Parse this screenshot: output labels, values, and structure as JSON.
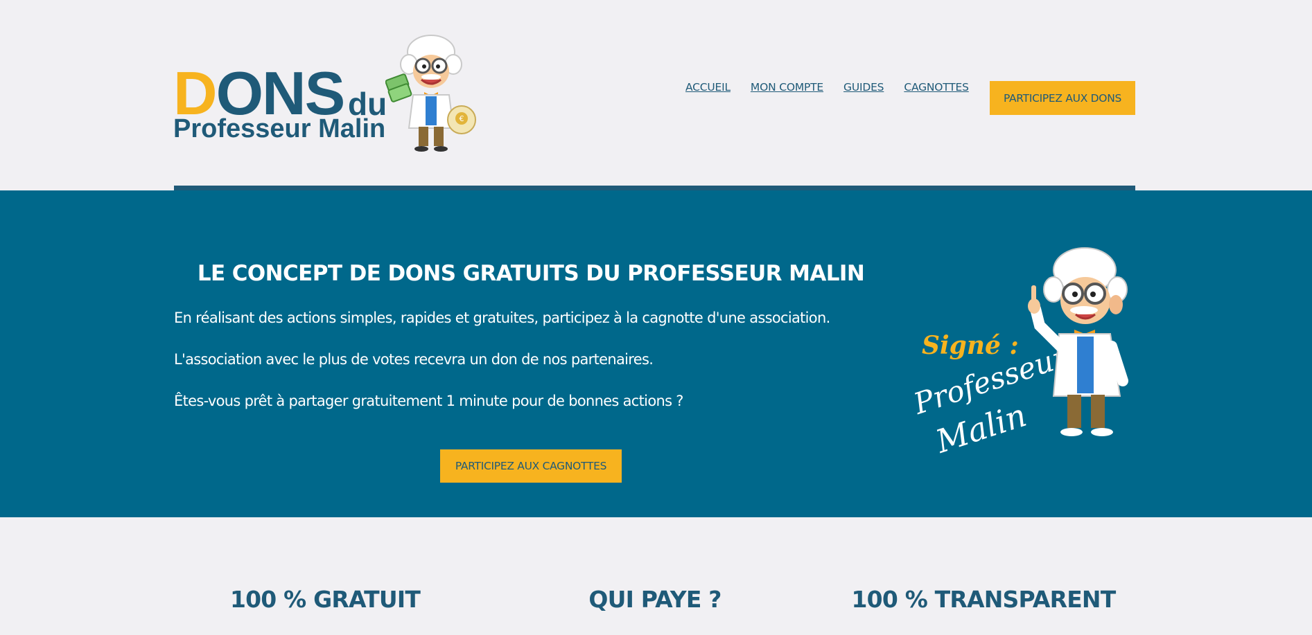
{
  "logo": {
    "word_first": "D",
    "word_rest": "ONS",
    "word_du": "du",
    "subtitle": "Professeur Malin",
    "coin_symbol": "€"
  },
  "nav": {
    "items": [
      {
        "label": "ACCUEIL"
      },
      {
        "label": "MON COMPTE"
      },
      {
        "label": "GUIDES"
      },
      {
        "label": "CAGNOTTES"
      }
    ],
    "cta_label": "PARTICIPEZ AUX DONS"
  },
  "hero": {
    "title": "LE CONCEPT DE DONS GRATUITS DU PROFESSEUR MALIN",
    "paragraphs": [
      "En réalisant des actions simples, rapides et gratuites, participez à la cagnotte d'une association.",
      "L'association avec le plus de votes recevra un don de nos partenaires.",
      "Êtes-vous prêt à partager gratuitement 1 minute pour de bonnes actions ?"
    ],
    "cta_label": "PARTICIPEZ AUX CAGNOTTES",
    "signature": {
      "signed_label": "Signé :",
      "name_line1": "Professeur",
      "name_line2": "Malin"
    }
  },
  "features": [
    {
      "title": "100 % GRATUIT"
    },
    {
      "title": "QUI PAYE ?"
    },
    {
      "title": "100 % TRANSPARENT"
    }
  ],
  "colors": {
    "background": "#f1f0f3",
    "primary": "#1f5a78",
    "hero": "#00688b",
    "accent": "#f7b31f",
    "white": "#ffffff"
  },
  "icons": {
    "logo_mascot": "professor-mascot-with-money-icon",
    "hero_mascot": "professor-mascot-pointing-icon"
  }
}
